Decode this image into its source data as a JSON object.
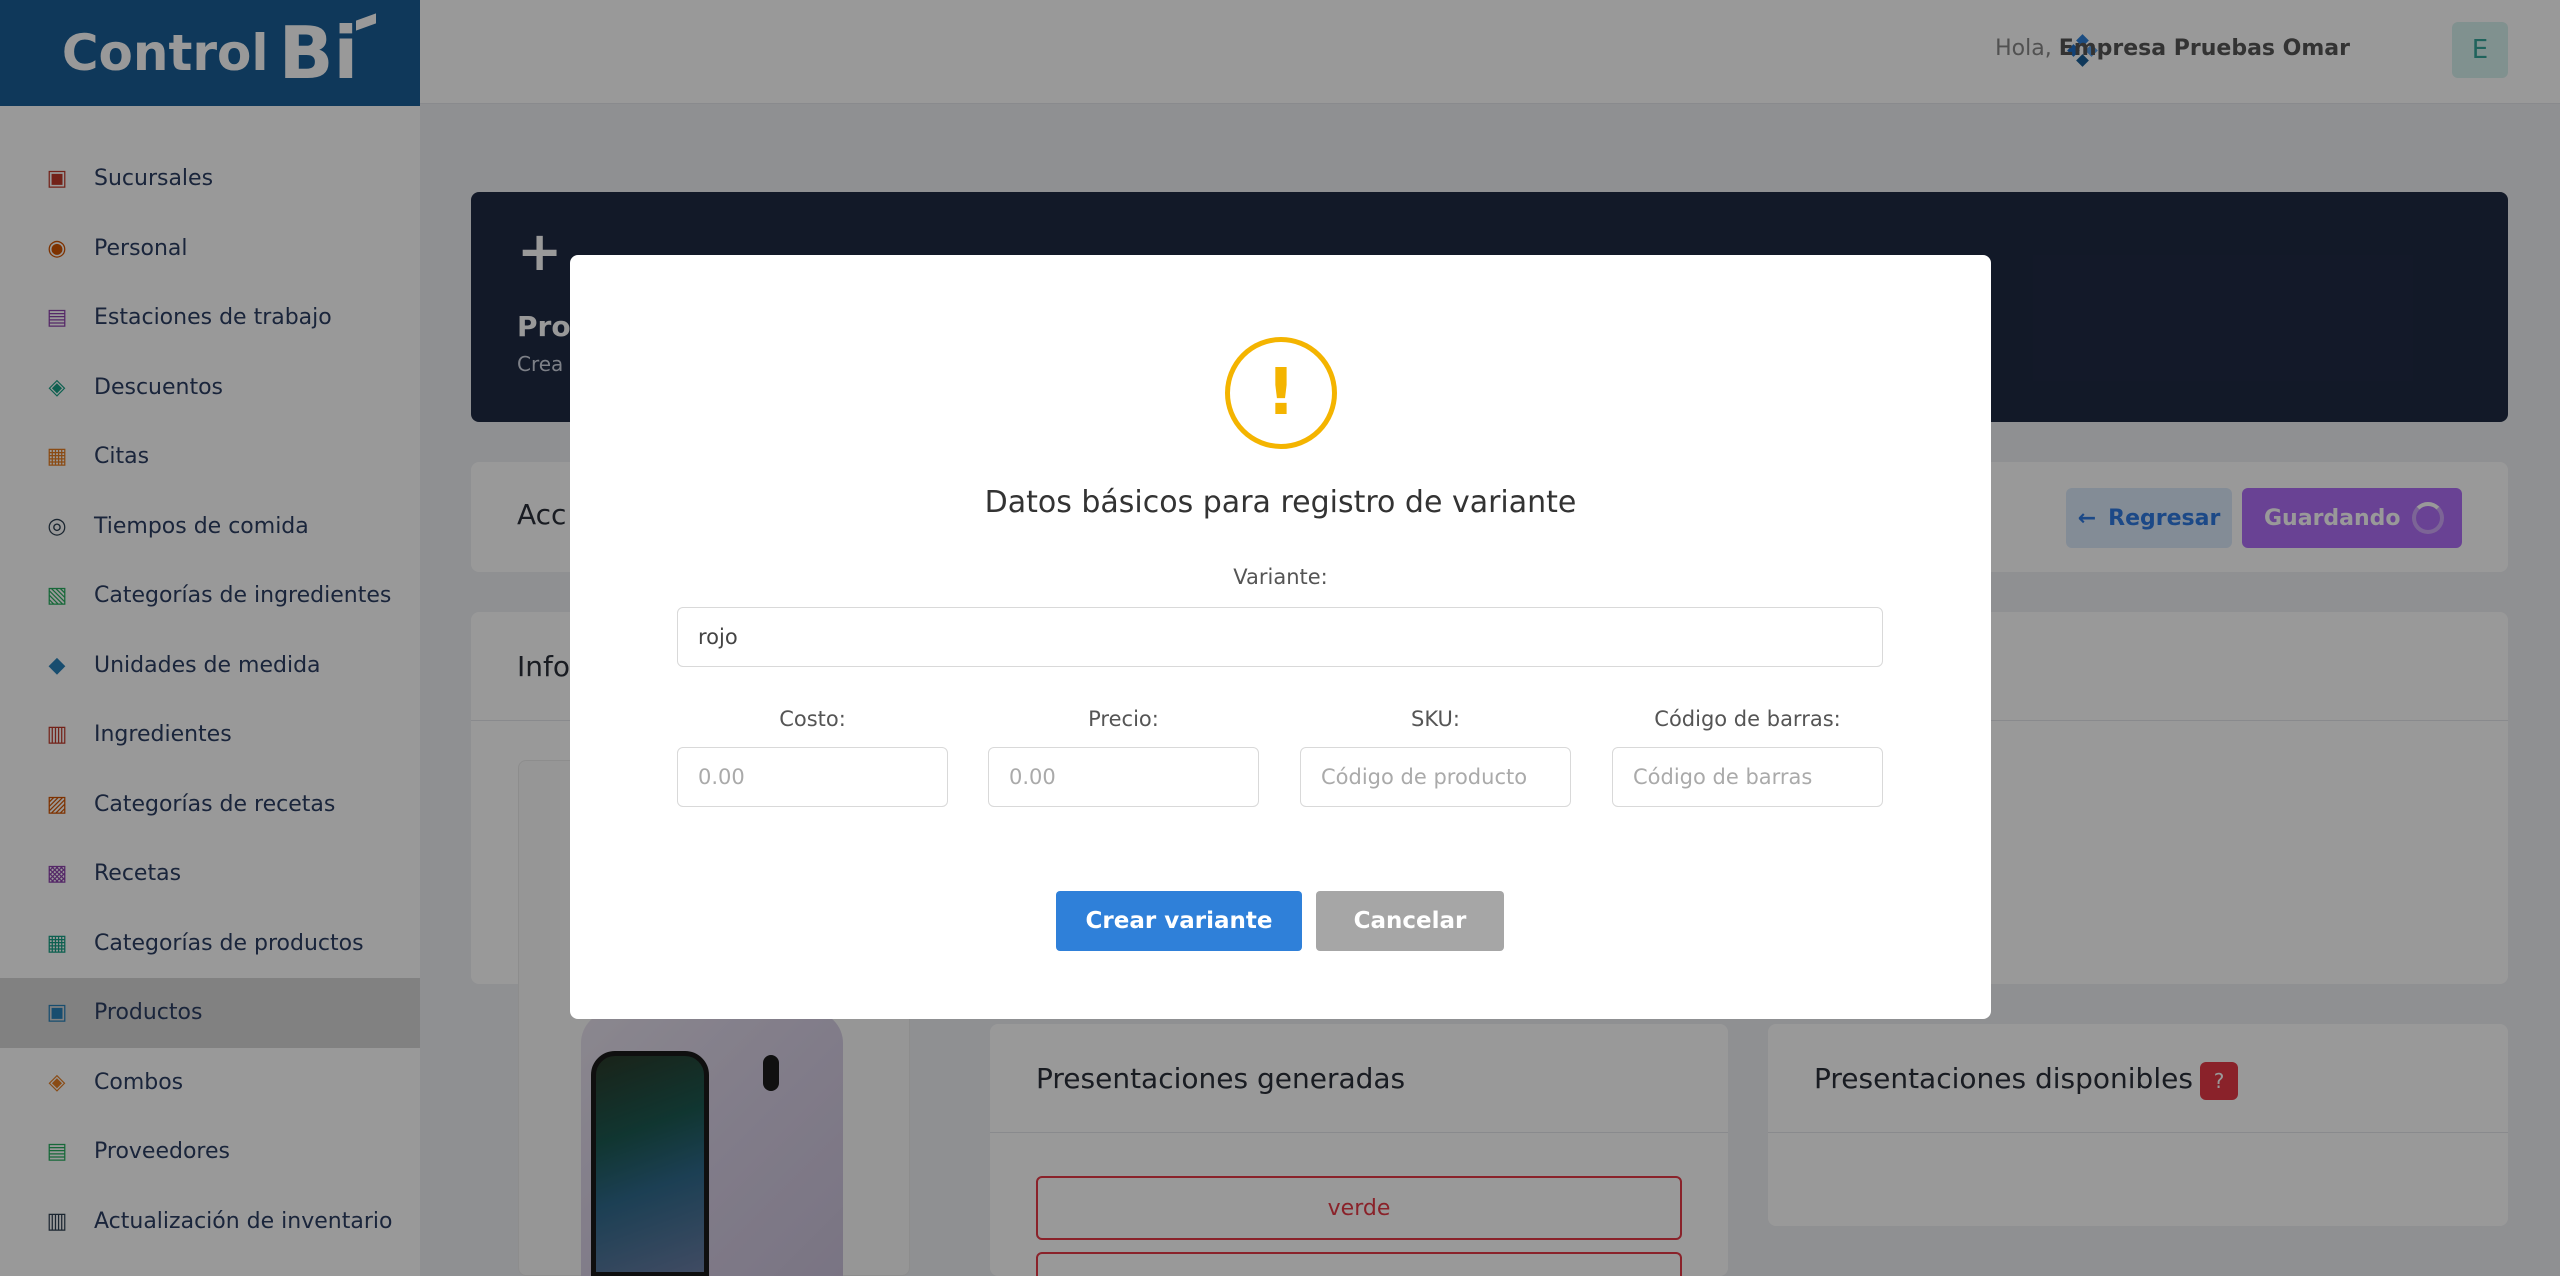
{
  "brand": {
    "name": "Control",
    "suffix": "Bi"
  },
  "user": {
    "greeting": "Hola,",
    "company": "Empresa Pruebas Omar",
    "avatar_initial": "E"
  },
  "sidebar": {
    "items": [
      {
        "label": "Sucursales",
        "icon": "store-icon"
      },
      {
        "label": "Personal",
        "icon": "people-icon"
      },
      {
        "label": "Estaciones de trabajo",
        "icon": "workstation-icon"
      },
      {
        "label": "Descuentos",
        "icon": "discount-icon"
      },
      {
        "label": "Citas",
        "icon": "calendar-icon"
      },
      {
        "label": "Tiempos de comida",
        "icon": "mealtime-icon"
      },
      {
        "label": "Categorías de ingredientes",
        "icon": "ingredient-category-icon"
      },
      {
        "label": "Unidades de medida",
        "icon": "measure-icon"
      },
      {
        "label": "Ingredientes",
        "icon": "ingredient-icon"
      },
      {
        "label": "Categorías de recetas",
        "icon": "recipe-category-icon"
      },
      {
        "label": "Recetas",
        "icon": "recipe-icon"
      },
      {
        "label": "Categorías de productos",
        "icon": "product-category-icon"
      },
      {
        "label": "Productos",
        "icon": "product-icon",
        "active": true
      },
      {
        "label": "Combos",
        "icon": "combo-icon"
      },
      {
        "label": "Proveedores",
        "icon": "supplier-icon"
      },
      {
        "label": "Actualización de inventario",
        "icon": "inventory-icon"
      }
    ]
  },
  "hero": {
    "plus": "+",
    "title": "Prod",
    "subtitle": "Crea"
  },
  "actions": {
    "title": "Acc",
    "back_label": "Regresar",
    "back_arrow": "←",
    "saving_label": "Guardando"
  },
  "info": {
    "title": "Infor"
  },
  "presentaciones_generadas": {
    "title": "Presentaciones generadas",
    "items": [
      "verde"
    ]
  },
  "presentaciones_disponibles": {
    "title": "Presentaciones disponibles"
  },
  "modal": {
    "icon": "!",
    "title": "Datos básicos para registro de variante",
    "variante_label": "Variante:",
    "variante_value": "rojo",
    "costo_label": "Costo:",
    "costo_placeholder": "0.00",
    "precio_label": "Precio:",
    "precio_placeholder": "0.00",
    "sku_label": "SKU:",
    "sku_placeholder": "Código de producto",
    "barcode_label": "Código de barras:",
    "barcode_placeholder": "Código de barras",
    "create_label": "Crear variante",
    "cancel_label": "Cancelar"
  },
  "colors": {
    "brand": "#1a5e96",
    "primary": "#2f80d9",
    "warning": "#f4b400",
    "danger": "#e63946",
    "saving": "#b06ff7"
  }
}
